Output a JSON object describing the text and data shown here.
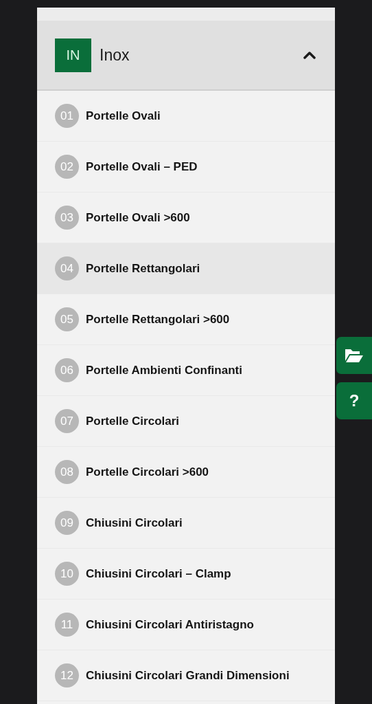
{
  "section": {
    "badge": "IN",
    "title": "Inox",
    "expanded": true
  },
  "items": [
    {
      "number": "01",
      "label": "Portelle Ovali",
      "selected": false
    },
    {
      "number": "02",
      "label": "Portelle Ovali – PED",
      "selected": false
    },
    {
      "number": "03",
      "label": "Portelle Ovali >600",
      "selected": false
    },
    {
      "number": "04",
      "label": "Portelle Rettangolari",
      "selected": true
    },
    {
      "number": "05",
      "label": "Portelle Rettangolari >600",
      "selected": false
    },
    {
      "number": "06",
      "label": "Portelle Ambienti Confinanti",
      "selected": false
    },
    {
      "number": "07",
      "label": "Portelle Circolari",
      "selected": false
    },
    {
      "number": "08",
      "label": "Portelle Circolari >600",
      "selected": false
    },
    {
      "number": "09",
      "label": "Chiusini Circolari",
      "selected": false
    },
    {
      "number": "10",
      "label": "Chiusini Circolari – Clamp",
      "selected": false
    },
    {
      "number": "11",
      "label": "Chiusini Circolari Antiristagno",
      "selected": false
    },
    {
      "number": "12",
      "label": "Chiusini Circolari Grandi Dimensioni",
      "selected": false
    }
  ],
  "side_buttons": [
    {
      "kind": "folder"
    },
    {
      "kind": "help",
      "label": "?"
    }
  ]
}
